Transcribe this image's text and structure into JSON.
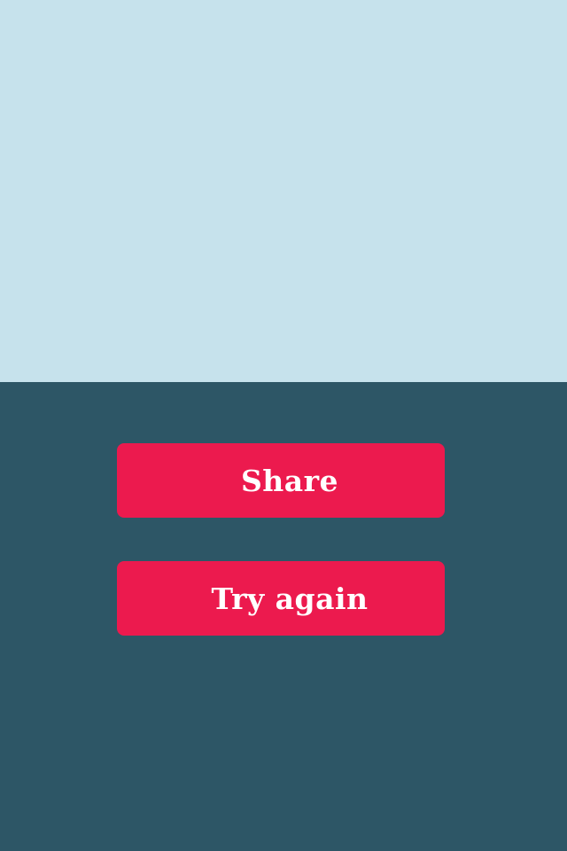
{
  "colors": {
    "sky": "#c6e2ec",
    "panel": "#2d5666",
    "button": "#ec1a4e",
    "button_text": "#ffffff"
  },
  "buttons": {
    "share_label": "Share",
    "try_again_label": "Try again"
  }
}
